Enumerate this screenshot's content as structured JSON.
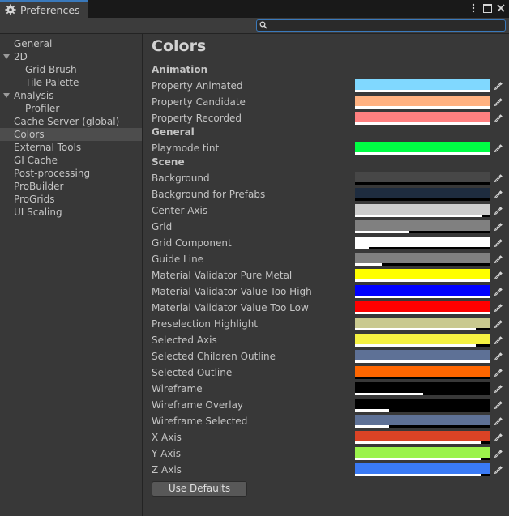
{
  "window": {
    "title": "Preferences",
    "menu_icon": "kebab-menu-icon",
    "maximize_icon": "maximize-icon",
    "close_icon": "close-icon"
  },
  "search": {
    "placeholder": ""
  },
  "sidebar": {
    "items": [
      {
        "label": "General",
        "indent": 0
      },
      {
        "label": "2D",
        "indent": 0,
        "expanded": true
      },
      {
        "label": "Grid Brush",
        "indent": 2
      },
      {
        "label": "Tile Palette",
        "indent": 2
      },
      {
        "label": "Analysis",
        "indent": 0,
        "expanded": true
      },
      {
        "label": "Profiler",
        "indent": 2
      },
      {
        "label": "Cache Server (global)",
        "indent": 0
      },
      {
        "label": "Colors",
        "indent": 0,
        "selected": true
      },
      {
        "label": "External Tools",
        "indent": 0
      },
      {
        "label": "GI Cache",
        "indent": 0
      },
      {
        "label": "Post-processing",
        "indent": 0
      },
      {
        "label": "ProBuilder",
        "indent": 0
      },
      {
        "label": "ProGrids",
        "indent": 0
      },
      {
        "label": "UI Scaling",
        "indent": 0
      }
    ]
  },
  "main": {
    "title": "Colors",
    "sections": [
      {
        "header": "Animation",
        "rows": [
          {
            "label": "Property Animated",
            "color": "#80d8ff",
            "alpha": 1.0
          },
          {
            "label": "Property Candidate",
            "color": "#ffb180",
            "alpha": 1.0
          },
          {
            "label": "Property Recorded",
            "color": "#ff8080",
            "alpha": 1.0
          }
        ]
      },
      {
        "header": "General",
        "rows": [
          {
            "label": "Playmode tint",
            "color": "#00ff44",
            "alpha": 1.0
          }
        ]
      },
      {
        "header": "Scene",
        "rows": [
          {
            "label": "Background",
            "color": "#474747",
            "alpha": 0.0
          },
          {
            "label": "Background for Prefabs",
            "color": "#1e2c3f",
            "alpha": 0.0
          },
          {
            "label": "Center Axis",
            "color": "#cccccc",
            "alpha": 0.94
          },
          {
            "label": "Grid",
            "color": "#808080",
            "alpha": 0.4
          },
          {
            "label": "Grid Component",
            "color": "#ffffff",
            "alpha": 0.1
          },
          {
            "label": "Guide Line",
            "color": "#808080",
            "alpha": 0.2
          },
          {
            "label": "Material Validator Pure Metal",
            "color": "#ffff00",
            "alpha": 1.0
          },
          {
            "label": "Material Validator Value Too High",
            "color": "#0000ff",
            "alpha": 1.0
          },
          {
            "label": "Material Validator Value Too Low",
            "color": "#ff0000",
            "alpha": 1.0
          },
          {
            "label": "Preselection Highlight",
            "color": "#c9c98f",
            "alpha": 0.89
          },
          {
            "label": "Selected Axis",
            "color": "#f6f242",
            "alpha": 0.89
          },
          {
            "label": "Selected Children Outline",
            "color": "#5e7196",
            "alpha": 1.0
          },
          {
            "label": "Selected Outline",
            "color": "#ff6600",
            "alpha": 0.0
          },
          {
            "label": "Wireframe",
            "color": "#000000",
            "alpha": 0.5
          },
          {
            "label": "Wireframe Overlay",
            "color": "#000000",
            "alpha": 0.25
          },
          {
            "label": "Wireframe Selected",
            "color": "#5e7196",
            "alpha": 0.25
          },
          {
            "label": "X Axis",
            "color": "#db4325",
            "alpha": 0.93
          },
          {
            "label": "Y Axis",
            "color": "#9bf34b",
            "alpha": 0.93
          },
          {
            "label": "Z Axis",
            "color": "#3a7af5",
            "alpha": 0.93
          }
        ]
      }
    ],
    "defaults_button": "Use Defaults",
    "picker_icon": "eyedropper-icon"
  },
  "colors": {
    "accent": "#3a79bb",
    "selection": "#4d4d4d",
    "background": "#383838"
  }
}
